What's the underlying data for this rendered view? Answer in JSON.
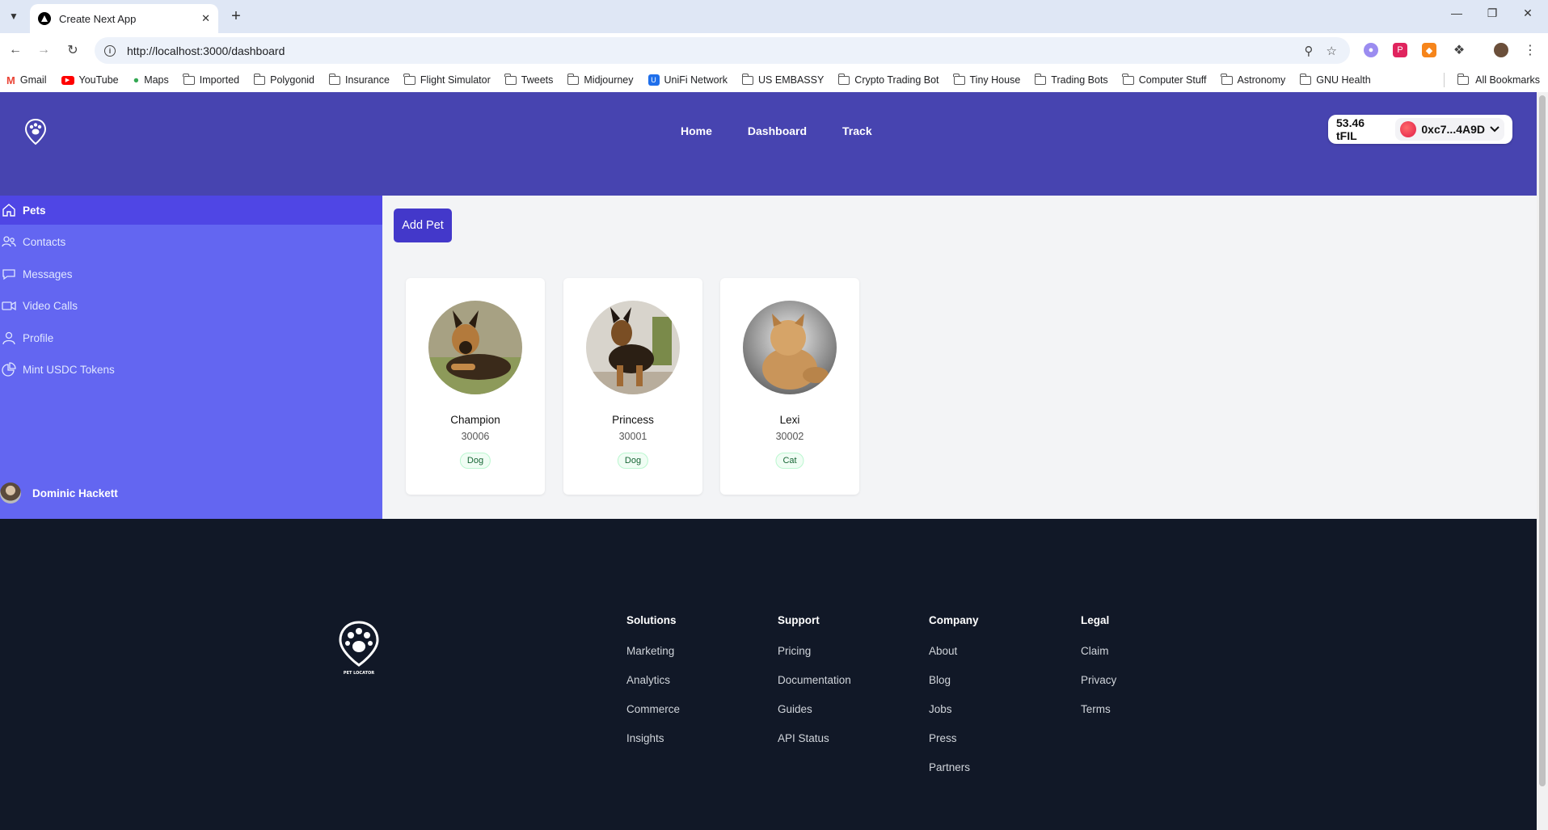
{
  "browser": {
    "tab_title": "Create Next App",
    "url": "http://localhost:3000/dashboard",
    "bookmarks": [
      "Gmail",
      "YouTube",
      "Maps",
      "Imported",
      "Polygonid",
      "Insurance",
      "Flight Simulator",
      "Tweets",
      "Midjourney",
      "UniFi Network",
      "US EMBASSY",
      "Crypto Trading Bot",
      "Tiny House",
      "Trading Bots",
      "Computer Stuff",
      "Astronomy",
      "GNU Health"
    ],
    "all_bookmarks": "All Bookmarks"
  },
  "header": {
    "nav": [
      "Home",
      "Dashboard",
      "Track"
    ],
    "wallet": {
      "balance": "53.46 tFIL",
      "address": "0xc7...4A9D"
    }
  },
  "sidebar": {
    "items": [
      {
        "label": "Pets",
        "icon": "home-icon"
      },
      {
        "label": "Contacts",
        "icon": "users-icon"
      },
      {
        "label": "Messages",
        "icon": "chat-icon"
      },
      {
        "label": "Video Calls",
        "icon": "video-icon"
      },
      {
        "label": "Profile",
        "icon": "user-icon"
      },
      {
        "label": "Mint USDC Tokens",
        "icon": "pie-chart-icon"
      }
    ],
    "user_name": "Dominic Hackett"
  },
  "content": {
    "add_pet_label": "Add Pet",
    "pets": [
      {
        "name": "Champion",
        "id": "30006",
        "type": "Dog"
      },
      {
        "name": "Princess",
        "id": "30001",
        "type": "Dog"
      },
      {
        "name": "Lexi",
        "id": "30002",
        "type": "Cat"
      }
    ]
  },
  "footer": {
    "logo_text": "PET LOCATOR",
    "columns": [
      {
        "heading": "Solutions",
        "links": [
          "Marketing",
          "Analytics",
          "Commerce",
          "Insights"
        ]
      },
      {
        "heading": "Support",
        "links": [
          "Pricing",
          "Documentation",
          "Guides",
          "API Status"
        ]
      },
      {
        "heading": "Company",
        "links": [
          "About",
          "Blog",
          "Jobs",
          "Press",
          "Partners"
        ]
      },
      {
        "heading": "Legal",
        "links": [
          "Claim",
          "Privacy",
          "Terms"
        ]
      }
    ]
  }
}
